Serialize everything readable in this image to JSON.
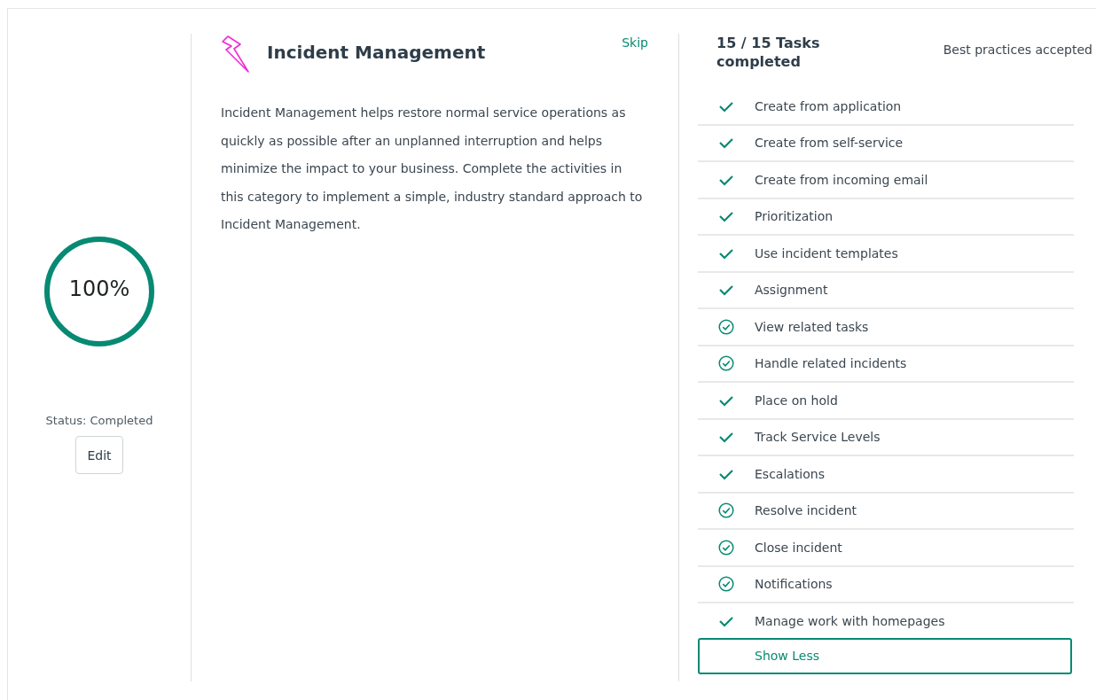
{
  "progress": {
    "level": 1,
    "label": "100%"
  },
  "status": "Status: Completed",
  "edit_button": "Edit",
  "category": {
    "title": "Incident Management",
    "skip": "Skip",
    "description": "Incident Management helps restore normal service operations as quickly as possible after an unplanned interruption and helps minimize the impact to your business. Complete the activities in this category to implement a simple, industry standard approach to Incident Management."
  },
  "tasks_summary": "15 / 15 Tasks completed",
  "best_practices": "Best practices accepted",
  "tasks": [
    {
      "label": "Create from application",
      "kind": "check"
    },
    {
      "label": "Create from self-service",
      "kind": "check"
    },
    {
      "label": "Create from incoming email",
      "kind": "check"
    },
    {
      "label": "Prioritization",
      "kind": "check"
    },
    {
      "label": "Use incident templates",
      "kind": "check"
    },
    {
      "label": "Assignment",
      "kind": "check"
    },
    {
      "label": "View related tasks",
      "kind": "circle-check"
    },
    {
      "label": "Handle related incidents",
      "kind": "circle-check"
    },
    {
      "label": "Place on hold",
      "kind": "check"
    },
    {
      "label": "Track Service Levels",
      "kind": "check"
    },
    {
      "label": "Escalations",
      "kind": "check"
    },
    {
      "label": "Resolve incident",
      "kind": "circle-check"
    },
    {
      "label": "Close incident",
      "kind": "circle-check"
    },
    {
      "label": "Notifications",
      "kind": "circle-check"
    },
    {
      "label": "Manage work with homepages",
      "kind": "check"
    }
  ],
  "show_less_button": "Show Less"
}
